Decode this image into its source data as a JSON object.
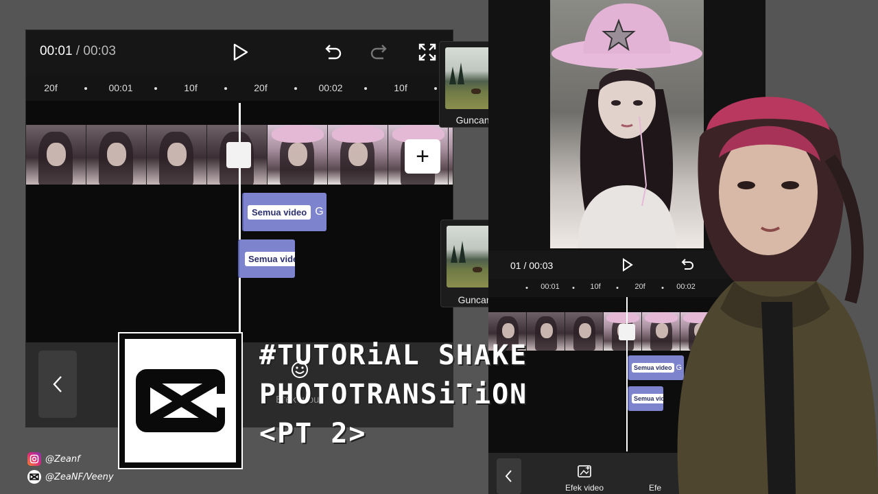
{
  "left_editor": {
    "time_current": "00:01",
    "time_separator": "/",
    "time_total": "00:03",
    "ruler": [
      "20f",
      "00:01",
      "10f",
      "20f",
      "00:02",
      "10f"
    ],
    "add_label": "+",
    "effect_clips": [
      {
        "label": "Semua video",
        "tail": "G"
      },
      {
        "label": "Semua vide"
      }
    ],
    "bottom_label": "Efek tubuh"
  },
  "thumbnails": [
    {
      "label": "Guncang"
    },
    {
      "label": "Guncang"
    }
  ],
  "right_editor": {
    "time_current": "01",
    "time_separator": "/",
    "time_total": "00:03",
    "ruler": [
      "00:01",
      "10f",
      "20f",
      "00:02"
    ],
    "effect_clips": [
      {
        "label": "Semua video",
        "tail": "G"
      },
      {
        "label": "Semua vid"
      }
    ],
    "tools": [
      {
        "label": "Efek video",
        "icon": "video-effect-icon"
      },
      {
        "label": "Efe"
      }
    ]
  },
  "title": {
    "line1": "#TUTORiAL SHAKE",
    "line2": "PHOTOTRANSiTiON",
    "line3": "<PT 2>"
  },
  "credits": {
    "instagram": "@Zeanf",
    "capcut": "@ZeaNF/Veeny"
  },
  "colors": {
    "background": "#555555",
    "effect_clip": "#7d83cc",
    "instagram_gradient": [
      "#f58529",
      "#dd2a7b",
      "#8134af"
    ]
  }
}
